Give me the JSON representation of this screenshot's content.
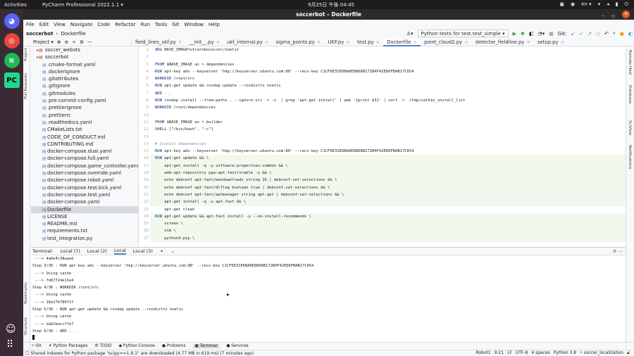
{
  "system": {
    "activities": "Activities",
    "app_menu": "PyCharm Professional 2022.1.1 ▾",
    "clock": "9月25日 午後 04:45",
    "lang": "en ▾"
  },
  "window": {
    "title": "soccerbot – Dockerfile"
  },
  "menu": [
    "File",
    "Edit",
    "View",
    "Navigate",
    "Code",
    "Refactor",
    "Run",
    "Tools",
    "Git",
    "Window",
    "Help"
  ],
  "breadcrumb": {
    "project": "soccerbot",
    "file": "Dockerfile"
  },
  "toolbar": {
    "run_config": "Python tests for test.test_simple ▾",
    "git_label": "Git:"
  },
  "project_panel": {
    "title": "Project ▾",
    "items": [
      {
        "name": "soccer_webots",
        "type": "folder"
      },
      {
        "name": "soccerbot",
        "type": "folder"
      },
      {
        "name": ".cmake-format.yaml"
      },
      {
        "name": ".dockerignore"
      },
      {
        "name": ".gitattributes"
      },
      {
        "name": ".gitignore"
      },
      {
        "name": ".gitmodules"
      },
      {
        "name": ".pre-commit-config.yaml"
      },
      {
        "name": ".prettierignore"
      },
      {
        "name": ".prettierrc"
      },
      {
        "name": ".readthedocs.yaml"
      },
      {
        "name": "CMakeLists.txt"
      },
      {
        "name": "CODE_OF_CONDUCT.md"
      },
      {
        "name": "CONTRIBUTING.md"
      },
      {
        "name": "docker-compose.dual.yaml"
      },
      {
        "name": "docker-compose.full.yaml"
      },
      {
        "name": "docker-compose.game_controller.yaml"
      },
      {
        "name": "docker-compose.override.yaml"
      },
      {
        "name": "docker-compose.robot.yaml"
      },
      {
        "name": "docker-compose.test.kick.yaml"
      },
      {
        "name": "docker-compose.test.yaml"
      },
      {
        "name": "docker-compose.yaml"
      },
      {
        "name": "Dockerfile",
        "selected": true
      },
      {
        "name": "LICENSE"
      },
      {
        "name": "README.md"
      },
      {
        "name": "requirements.txt"
      },
      {
        "name": "test_integration.py"
      }
    ]
  },
  "editor_tabs": [
    {
      "label": "field_lines_ukf.py"
    },
    {
      "label": "__init__.py"
    },
    {
      "label": "ukf_internal.py"
    },
    {
      "label": "sigma_points.py"
    },
    {
      "label": "UKF.py"
    },
    {
      "label": "test.py"
    },
    {
      "label": "Dockerfile",
      "active": true
    },
    {
      "label": "point_cloud2.py"
    },
    {
      "label": "detector_fieldline.py"
    },
    {
      "label": "setup.py"
    }
  ],
  "code": [
    {
      "kw": "ARG",
      "rest": " BASE_IMAGE=utrarobosoccer/noetic"
    },
    {
      "kw": "",
      "rest": ""
    },
    {
      "kw": "FROM",
      "rest": " $BASE_IMAGE as ✎ dependencies"
    },
    {
      "kw": "RUN",
      "rest": " apt-key adv --keyserver 'hkp://keyserver.ubuntu.com:80' --recv-key C1CF6E31E6BADE8868B172B4F42ED6FBAB17C654"
    },
    {
      "kw": "WORKDIR",
      "rest": " /root/src"
    },
    {
      "kw": "RUN",
      "rest": " apt-get update && rosdep update --rosdistro noetic"
    },
    {
      "kw": "ADD",
      "rest": " . ."
    },
    {
      "kw": "RUN",
      "rest": " rosdep install --from-paths . --ignore-src -r -s  | grep 'apt-get install' | awk '{print $3}' | sort  >  /tmp/catkin_install_list"
    },
    {
      "kw": "WORKDIR",
      "rest": " /root/dependencies"
    },
    {
      "kw": "",
      "rest": ""
    },
    {
      "kw": "FROM",
      "rest": " $BASE_IMAGE as ✎ builder"
    },
    {
      "kw": "SHELL",
      "rest": " [\"/bin/bash\", \"-c\"]"
    },
    {
      "kw": "",
      "rest": ""
    },
    {
      "kw": "",
      "rest": "# Install dependencies",
      "comment": true
    },
    {
      "kw": "RUN",
      "rest": " apt-key adv --keyserver 'hkp://keyserver.ubuntu.com:80' --recv-key C1CF6E31E6BADE8868B172B4F42ED6FBAB17C654"
    },
    {
      "kw": "RUN",
      "rest": " apt-get update && \\",
      "g": true
    },
    {
      "kw": "",
      "rest": "    apt-get install -q -y software-properties-common && \\",
      "g": true
    },
    {
      "kw": "",
      "rest": "    add-apt-repository ppa:apt-fast/stable -y && \\",
      "g": true
    },
    {
      "kw": "",
      "rest": "    echo debconf apt-fast/maxdownloads string 16 | debconf-set-selections && \\",
      "g": true
    },
    {
      "kw": "",
      "rest": "    echo debconf apt-fast/dlflag boolean true | debconf-set-selections && \\",
      "g": true
    },
    {
      "kw": "",
      "rest": "    echo debconf apt-fast/aptmanager string apt-get | debconf-set-selections && \\",
      "g": true
    },
    {
      "kw": "",
      "rest": "    apt-get install -q -y apt-fast && \\",
      "g": true
    },
    {
      "kw": "",
      "rest": "    apt-get clean"
    },
    {
      "kw": "RUN",
      "rest": " apt-get update && apt-fast install -y --no-install-recommends \\",
      "g": true
    },
    {
      "kw": "",
      "rest": "    screen \\",
      "g": true
    },
    {
      "kw": "",
      "rest": "    vim \\",
      "g": true
    },
    {
      "kw": "",
      "rest": "    python3-pip \\",
      "g": true
    }
  ],
  "terminal": {
    "label": "Terminal:",
    "tabs": [
      {
        "label": "Local (7)"
      },
      {
        "label": "Local (2)"
      },
      {
        "label": "Local",
        "active": true
      },
      {
        "label": "Local (3)"
      }
    ],
    "add": "+",
    "lines": [
      " ---> 4a6e4c38aaed",
      "Step 3/36 : RUN apt-key adv --keyserver 'hkp://keyserver.ubuntu.com:80' --recv-key C1CF6E31E6BADE8868B172B4F42ED6FBAB17C654",
      " ---> Using cache",
      " ---> 7d67724e11e4",
      "Step 4/36 : WORKDIR /root/src",
      " ---> Using cache",
      " ---> 18a17b789f1f",
      "Step 5/36 : RUN apt-get update && rosdep update --rosdistro noetic",
      " ---> Using cache",
      " ---> dab2bacc7fe7",
      "Step 6/36 : ADD . ."
    ]
  },
  "tool_windows": [
    "Git",
    "Python Packages",
    "TODO",
    "Python Console",
    "Problems",
    "Terminal",
    "Services"
  ],
  "left_strip": [
    "Project",
    "Pull Requests",
    "Bookmarks",
    "Structure"
  ],
  "right_strip": [
    "Remote Host",
    "Database",
    "SciView",
    "Notifications"
  ],
  "status": {
    "message": "Shared indexes for Python package \"scipy==1.9.1\" are downloaded (4.77 MB in 619 ms) (7 minutes ago)",
    "robot": "Robot1",
    "pos": "9:21",
    "eol": "LF",
    "enc": "UTF-8",
    "indent": "4 spaces",
    "interpreter": "Python 3.8",
    "branch": "soccer_localization"
  }
}
